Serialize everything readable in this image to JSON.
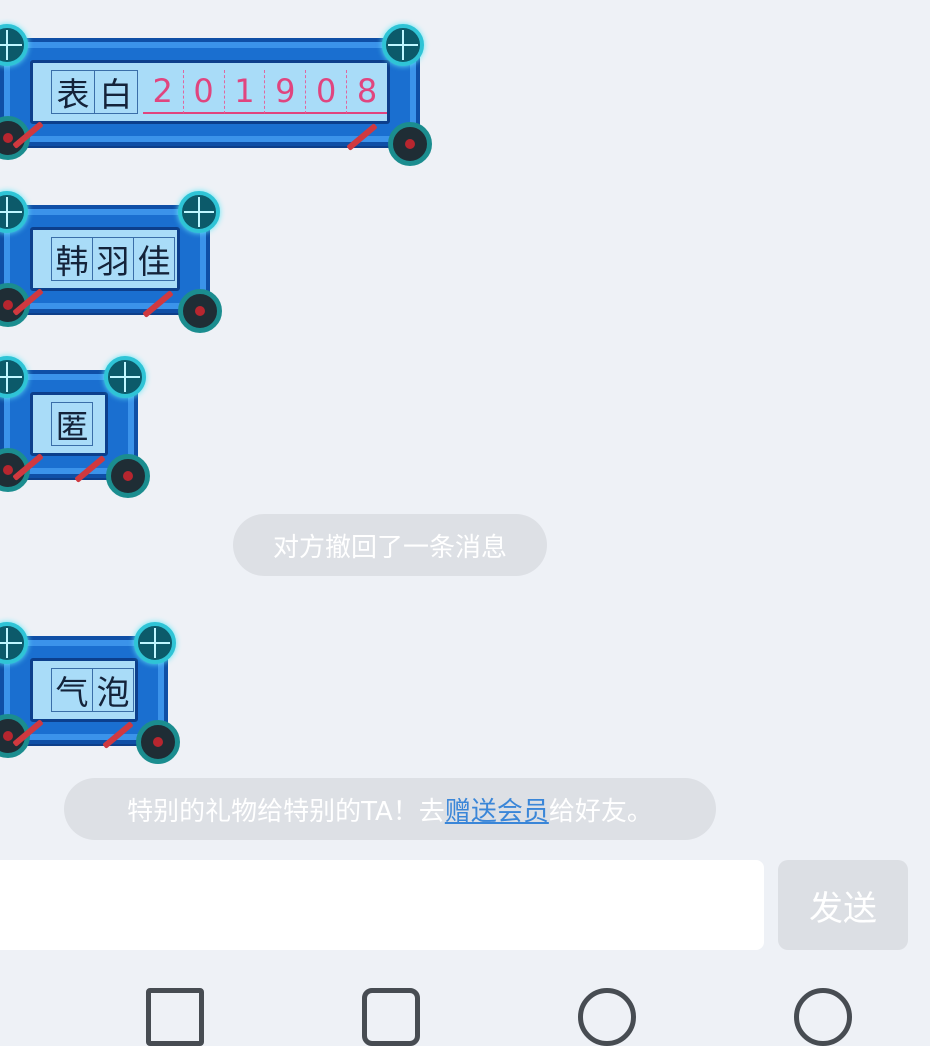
{
  "messages": [
    {
      "chars": [
        "表",
        "白"
      ],
      "handwriting": [
        "2",
        "0",
        "1",
        "9",
        "0",
        "8"
      ]
    },
    {
      "chars": [
        "韩",
        "羽",
        "佳"
      ]
    },
    {
      "chars": [
        "匿"
      ]
    },
    {
      "chars": [
        "气",
        "泡"
      ]
    }
  ],
  "system": {
    "recall_notice": "对方撤回了一条消息",
    "promo_prefix": "特别的礼物给特别的TA！去",
    "promo_link": "赠送会员",
    "promo_suffix": "给好友。"
  },
  "composer": {
    "send_label": "发送"
  },
  "toolbar": {
    "icons": [
      "image-icon",
      "camera-icon",
      "emoji-icon",
      "more-icon"
    ]
  },
  "colors": {
    "background": "#eef1f6",
    "bubble_blue": "#1a6fd0",
    "bubble_inner": "#a9dcf8",
    "link": "#3a86d8",
    "pill": "#dde0e5"
  }
}
